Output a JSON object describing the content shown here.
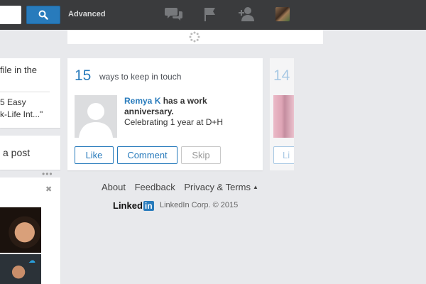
{
  "topbar": {
    "search_placeholder": "",
    "advanced_label": "Advanced",
    "icons": [
      "search-icon",
      "messages-icon",
      "notifications-flag-icon",
      "add-connections-icon",
      "profile-avatar"
    ]
  },
  "left_column": {
    "profile_tip": "file in the",
    "article_line1": "5 Easy",
    "article_line2": "k-Life Int...\"",
    "share_prompt": "a post"
  },
  "keep_in_touch": {
    "count": "15",
    "title": "ways to keep in touch",
    "person_name": "Remya K",
    "event_prefix": " has a work",
    "event_suffix": "anniversary.",
    "detail": "Celebrating 1 year at D+H",
    "buttons": {
      "like": "Like",
      "comment": "Comment",
      "skip": "Skip"
    }
  },
  "next_card": {
    "count": "14",
    "button_partial": "Li"
  },
  "footer": {
    "about": "About",
    "feedback": "Feedback",
    "privacy_terms": "Privacy & Terms",
    "logo_text": "Linked",
    "logo_box": "in",
    "copyright": "LinkedIn Corp. © 2015"
  },
  "colors": {
    "brand_blue": "#287bbc",
    "topbar_bg": "#3a3b3d",
    "page_bg": "#e8e9ec"
  }
}
